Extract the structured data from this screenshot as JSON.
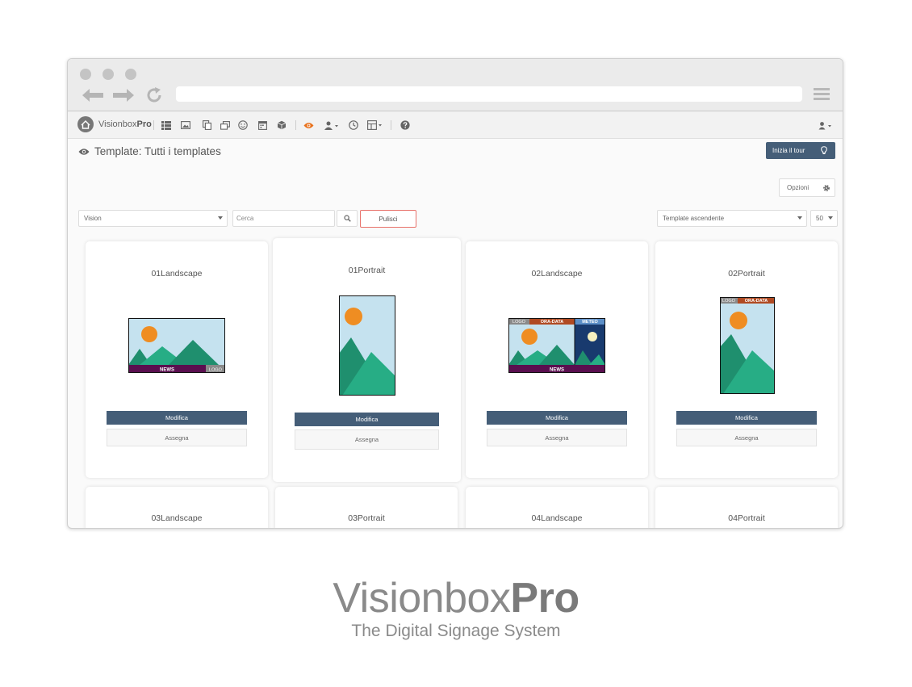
{
  "app": {
    "brand_light": "Visionbox",
    "brand_bold": "Pro"
  },
  "page": {
    "title": "Template: Tutti i templates",
    "tour_label": "Inizia il tour",
    "options_label": "Opzioni"
  },
  "filters": {
    "category": "Vision",
    "search_placeholder": "Cerca",
    "clear_label": "Pulisci",
    "sort": "Template ascendente",
    "page_size": "50"
  },
  "cards": [
    {
      "title": "01Landscape",
      "edit_label": "Modifica",
      "assign_label": "Assegna",
      "footer_label": "NEWS",
      "logo_label": "LOGO"
    },
    {
      "title": "01Portrait",
      "edit_label": "Modifica",
      "assign_label": "Assegna"
    },
    {
      "title": "02Landscape",
      "edit_label": "Modifica",
      "assign_label": "Assegna",
      "logo_label": "LOGO",
      "clock_label": "ORA-DATA",
      "weather_label": "METEO",
      "footer_label": "NEWS"
    },
    {
      "title": "02Portrait",
      "edit_label": "Modifica",
      "assign_label": "Assegna",
      "logo_label": "LOGO",
      "clock_label": "ORA-DATA"
    },
    {
      "title": "03Landscape"
    },
    {
      "title": "03Portrait"
    },
    {
      "title": "04Landscape"
    },
    {
      "title": "04Portrait"
    }
  ],
  "footer": {
    "brand_light": "Visionbox",
    "brand_bold": "Pro",
    "tagline": "The Digital Signage System"
  },
  "colors": {
    "primary": "#455e78",
    "accent": "#e8711c",
    "clear_border": "#e8726b",
    "sky": "#c5e2ef",
    "mountain_dark": "#1f8f6e",
    "mountain_light": "#27ad85",
    "sun": "#ef8d22",
    "news_bar": "#5a0f4f",
    "clock_bar": "#b04a22",
    "night_sky": "#183a6e"
  }
}
